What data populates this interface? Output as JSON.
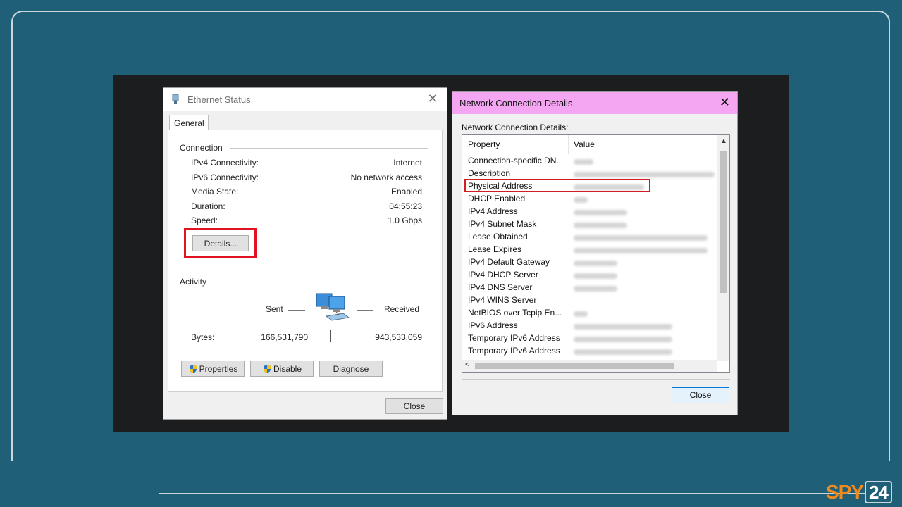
{
  "brand": {
    "part1": "SPY",
    "part2": "24",
    "accent": "#f08a1c"
  },
  "ethernet": {
    "title": "Ethernet Status",
    "tab": "General",
    "connection_label": "Connection",
    "rows": [
      {
        "label": "IPv4 Connectivity:",
        "value": "Internet"
      },
      {
        "label": "IPv6 Connectivity:",
        "value": "No network access"
      },
      {
        "label": "Media State:",
        "value": "Enabled"
      },
      {
        "label": "Duration:",
        "value": "04:55:23"
      },
      {
        "label": "Speed:",
        "value": "1.0 Gbps"
      }
    ],
    "details_button": "Details...",
    "activity_label": "Activity",
    "sent_label": "Sent",
    "received_label": "Received",
    "bytes_label": "Bytes:",
    "bytes_sent": "166,531,790",
    "bytes_received": "943,533,059",
    "properties_button": "Properties",
    "disable_button": "Disable",
    "diagnose_button": "Diagnose",
    "close_button": "Close"
  },
  "details": {
    "title": "Network Connection Details",
    "subtitle": "Network Connection Details:",
    "col_property": "Property",
    "col_value": "Value",
    "properties": [
      "Connection-specific DN...",
      "Description",
      "Physical Address",
      "DHCP Enabled",
      "IPv4 Address",
      "IPv4 Subnet Mask",
      "Lease Obtained",
      "Lease Expires",
      "IPv4 Default Gateway",
      "IPv4 DHCP Server",
      "IPv4 DNS Server",
      "IPv4 WINS Server",
      "NetBIOS over Tcpip En...",
      "IPv6 Address",
      "Temporary IPv6 Address",
      "Temporary IPv6 Address"
    ],
    "highlighted_property": "Physical Address",
    "close_button": "Close"
  }
}
